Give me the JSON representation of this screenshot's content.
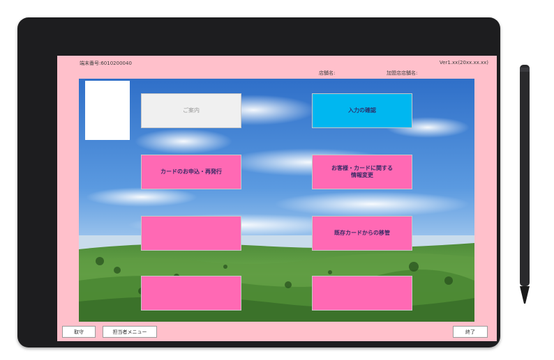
{
  "header": {
    "terminal_no": "端末番号:6010200040",
    "version": "Ver1.xx(20xx.xx.xx)",
    "store_label": "店舗名:",
    "merchant_label": "加盟店店舗名:"
  },
  "tiles": [
    {
      "label": "ご案内",
      "style": "gray"
    },
    {
      "label": "入力の確認",
      "style": "cyan"
    },
    {
      "label": "カードのお申込・再発行",
      "style": "pink"
    },
    {
      "label": "お客様・カードに関する\n情報変更",
      "style": "pink"
    },
    {
      "label": "",
      "style": "pink"
    },
    {
      "label": "既存カードからの移管",
      "style": "pink"
    },
    {
      "label": "",
      "style": "pink"
    },
    {
      "label": "",
      "style": "pink"
    }
  ],
  "footer": {
    "back_label": "取守",
    "staff_menu_label": "担当者メニュー",
    "exit_label": "終了"
  },
  "colors": {
    "screen_bg": "#ffc0cb",
    "tile_pink": "#ff69b4",
    "tile_cyan": "#00b7f0",
    "tile_gray": "#f0f0f0",
    "device_frame": "#1d1d1f"
  }
}
